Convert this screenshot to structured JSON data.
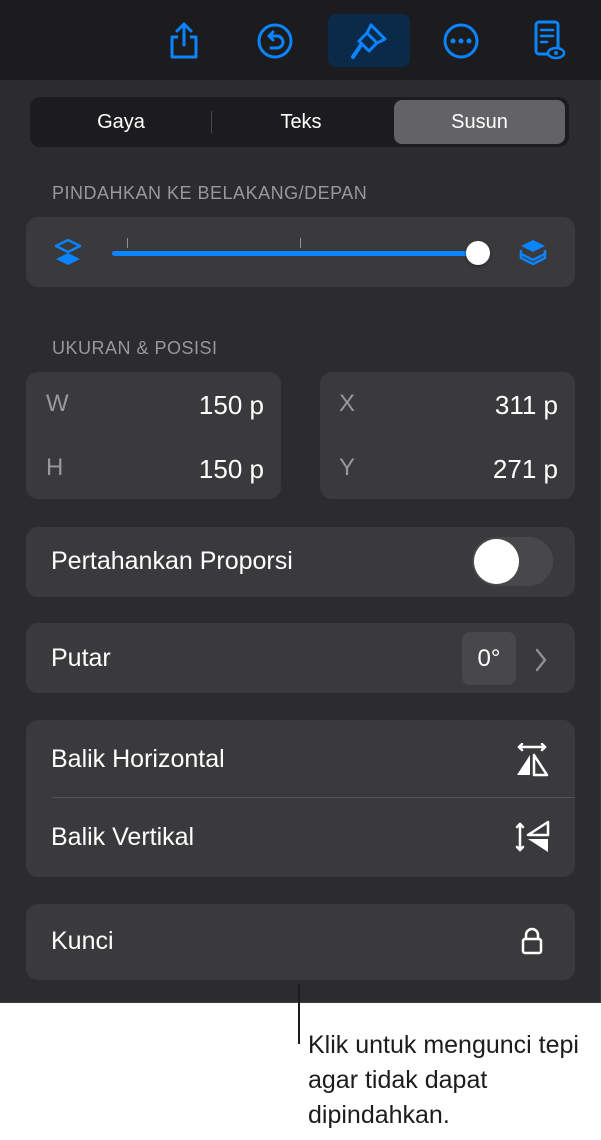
{
  "colors": {
    "accent": "#0a84ff",
    "panel": "#2c2c2e",
    "card": "#3a3a3c",
    "toolbar": "#1c1c1e"
  },
  "toolbar": {
    "icons": [
      "share-icon",
      "undo-icon",
      "format-brush-icon",
      "more-icon",
      "reader-view-icon"
    ],
    "active": "format-brush-icon"
  },
  "tabs": {
    "items": [
      "Gaya",
      "Teks",
      "Susun"
    ],
    "selected": "Susun"
  },
  "arrange": {
    "label": "PINDAHKAN KE BELAKANG/DEPAN",
    "slider_fraction": 1.0,
    "left_icon": "send-backward-icon",
    "right_icon": "bring-forward-icon"
  },
  "size_position": {
    "label": "UKURAN & POSISI",
    "w_label": "W",
    "w_value": "150 p",
    "h_label": "H",
    "h_value": "150 p",
    "x_label": "X",
    "x_value": "311 p",
    "y_label": "Y",
    "y_value": "271 p"
  },
  "proportion": {
    "label": "Pertahankan Proporsi",
    "on": false
  },
  "rotate": {
    "label": "Putar",
    "value": "0°"
  },
  "flip": {
    "horizontal": "Balik Horizontal",
    "vertical": "Balik Vertikal"
  },
  "lock": {
    "label": "Kunci"
  },
  "callout": {
    "text": "Klik untuk mengunci tepi agar tidak dapat dipindahkan."
  }
}
